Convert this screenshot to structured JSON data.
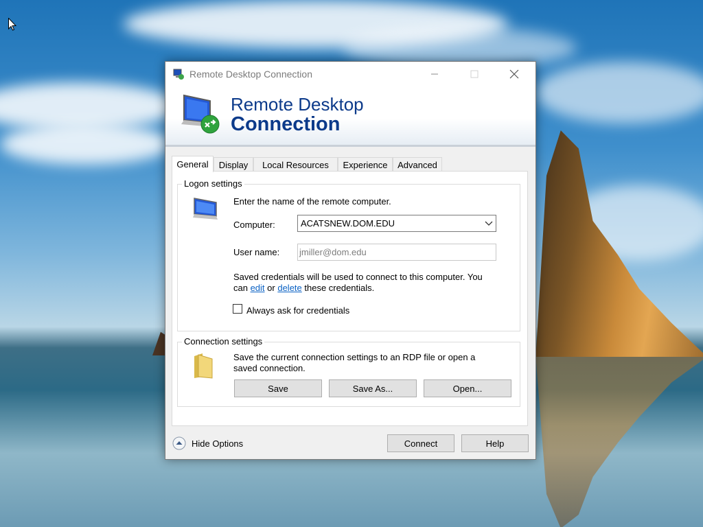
{
  "window": {
    "title": "Remote Desktop Connection",
    "controls": {
      "minimize": "—",
      "maximize": "☐",
      "close": "✕"
    }
  },
  "banner": {
    "line1": "Remote Desktop",
    "line2": "Connection"
  },
  "tabs": [
    {
      "label": "General",
      "active": true
    },
    {
      "label": "Display",
      "active": false
    },
    {
      "label": "Local Resources",
      "active": false
    },
    {
      "label": "Experience",
      "active": false
    },
    {
      "label": "Advanced",
      "active": false
    }
  ],
  "logon": {
    "group_title": "Logon settings",
    "intro": "Enter the name of the remote computer.",
    "computer_label": "Computer:",
    "computer_value": "ACATSNEW.DOM.EDU",
    "username_label": "User name:",
    "username_value": "jmiller@dom.edu",
    "saved_text_1": "Saved credentials will be used to connect to this computer.  You",
    "saved_text_2a": "can ",
    "edit_link": "edit",
    "saved_text_2b": " or ",
    "delete_link": "delete",
    "saved_text_2c": " these credentials.",
    "always_ask_label": "Always ask for credentials",
    "always_ask_checked": false
  },
  "connection": {
    "group_title": "Connection settings",
    "desc_1": "Save the current connection settings to an RDP file or open a",
    "desc_2": "saved connection.",
    "save_label": "Save",
    "save_as_label": "Save As...",
    "open_label": "Open..."
  },
  "footer": {
    "hide_options_label": "Hide Options",
    "connect_label": "Connect",
    "help_label": "Help"
  },
  "colors": {
    "banner_text": "#0c3a8a",
    "link": "#0b62c4"
  },
  "icons": [
    "remote-desktop-icon",
    "computer-icon",
    "folder-icon",
    "chevron-up-icon",
    "chevron-down-icon"
  ]
}
